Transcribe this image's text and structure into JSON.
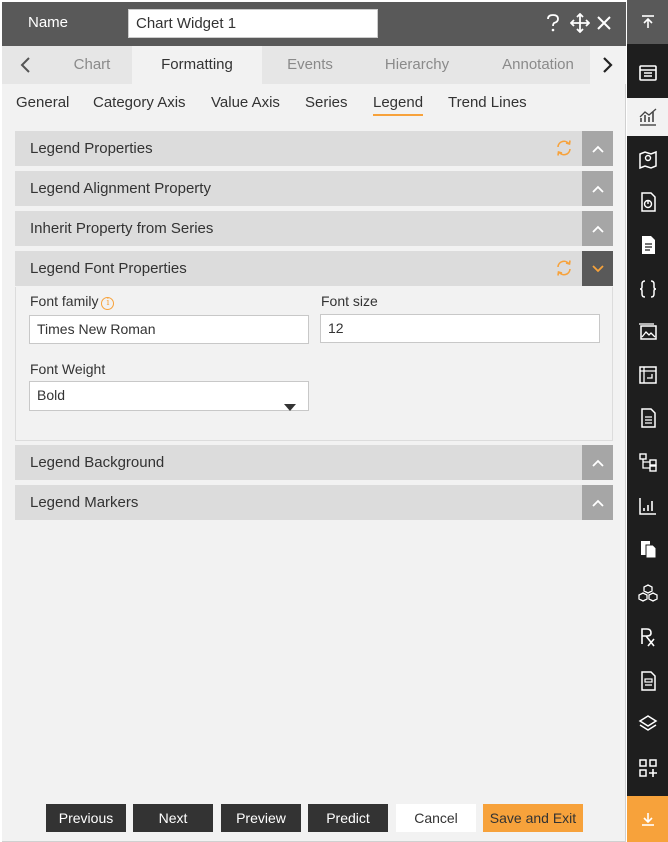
{
  "header": {
    "name_label": "Name",
    "name_value": "Chart Widget 1",
    "help_icon": "question-icon",
    "move_icon": "move-icon",
    "close_icon": "close-icon"
  },
  "tabs": [
    {
      "label": "Chart"
    },
    {
      "label": "Formatting"
    },
    {
      "label": "Events"
    },
    {
      "label": "Hierarchy"
    },
    {
      "label": "Annotation"
    }
  ],
  "active_tab": "Formatting",
  "subtabs": [
    {
      "label": "General"
    },
    {
      "label": "Category Axis"
    },
    {
      "label": "Value Axis"
    },
    {
      "label": "Series"
    },
    {
      "label": "Legend"
    },
    {
      "label": "Trend Lines"
    }
  ],
  "active_subtab": "Legend",
  "sections": [
    {
      "title": "Legend Properties"
    },
    {
      "title": "Legend Alignment Property"
    },
    {
      "title": "Inherit Property from Series"
    },
    {
      "title": "Legend Font Properties"
    },
    {
      "title": "Legend Background"
    },
    {
      "title": "Legend Markers"
    }
  ],
  "font_props": {
    "font_family_label": "Font family",
    "font_family_value": "Times New Roman",
    "font_size_label": "Font size",
    "font_size_value": "12",
    "font_weight_label": "Font Weight",
    "font_weight_value": "Bold"
  },
  "footer": {
    "previous": "Previous",
    "next": "Next",
    "preview": "Preview",
    "predict": "Predict",
    "cancel": "Cancel",
    "save_exit": "Save and Exit"
  },
  "colors": {
    "accent": "#f7a23b",
    "header": "#595959",
    "sidebar": "#1e1e1e"
  }
}
